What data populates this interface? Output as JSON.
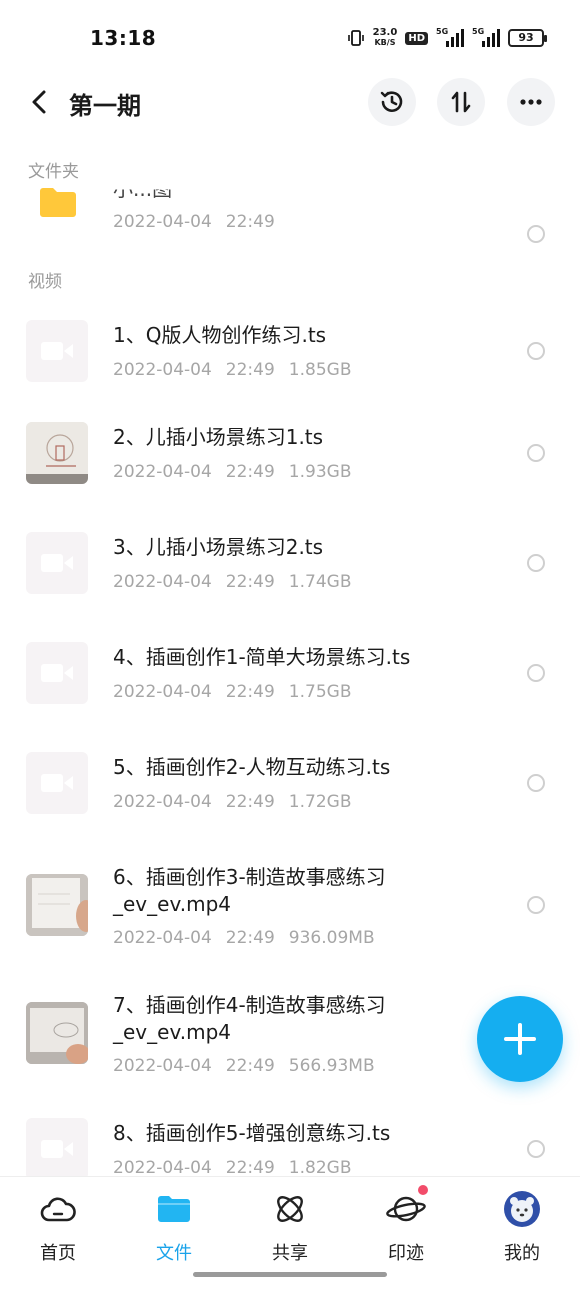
{
  "status_bar": {
    "time": "13:18",
    "speed_value": "23.0",
    "speed_unit": "KB/S",
    "hd": "HD",
    "network_1": "5G",
    "network_2": "5G",
    "battery": "93"
  },
  "header": {
    "title": "第一期",
    "back_icon": "chevron-left-icon",
    "history_icon": "history-icon",
    "sort_icon": "sort-icon",
    "more_icon": "more-icon"
  },
  "sections": {
    "folders_label": "文件夹",
    "videos_label": "视频"
  },
  "folders": [
    {
      "name": "小...图",
      "date": "2022-04-04",
      "time": "22:49"
    }
  ],
  "videos": [
    {
      "name": "1、Q版人物创作练习.ts",
      "date": "2022-04-04",
      "time": "22:49",
      "size": "1.85GB",
      "thumb": "video-placeholder-icon"
    },
    {
      "name": "2、儿插小场景练习1.ts",
      "date": "2022-04-04",
      "time": "22:49",
      "size": "1.93GB",
      "thumb": "sketch-thumbnail"
    },
    {
      "name": "3、儿插小场景练习2.ts",
      "date": "2022-04-04",
      "time": "22:49",
      "size": "1.74GB",
      "thumb": "video-placeholder-icon"
    },
    {
      "name": "4、插画创作1-简单大场景练习.ts",
      "date": "2022-04-04",
      "time": "22:49",
      "size": "1.75GB",
      "thumb": "video-placeholder-icon"
    },
    {
      "name": "5、插画创作2-人物互动练习.ts",
      "date": "2022-04-04",
      "time": "22:49",
      "size": "1.72GB",
      "thumb": "video-placeholder-icon"
    },
    {
      "name": "6、插画创作3-制造故事感练习_ev_ev.mp4",
      "date": "2022-04-04",
      "time": "22:49",
      "size": "936.09MB",
      "thumb": "drawing-thumbnail"
    },
    {
      "name": "7、插画创作4-制造故事感练习_ev_ev.mp4",
      "date": "2022-04-04",
      "time": "22:49",
      "size": "566.93MB",
      "thumb": "drawing-thumbnail"
    },
    {
      "name": "8、插画创作5-增强创意练习.ts",
      "date": "2022-04-04",
      "time": "22:49",
      "size": "1.82GB",
      "thumb": "video-placeholder-icon"
    }
  ],
  "fab": {
    "icon": "plus-icon"
  },
  "bottom_nav": [
    {
      "label": "首页",
      "icon": "cloud-icon",
      "active": false
    },
    {
      "label": "文件",
      "icon": "folder-icon",
      "active": true
    },
    {
      "label": "共享",
      "icon": "atom-icon",
      "active": false
    },
    {
      "label": "印迹",
      "icon": "planet-icon",
      "active": false,
      "badge_dot": true
    },
    {
      "label": "我的",
      "icon": "avatar-icon",
      "active": false
    }
  ],
  "colors": {
    "accent": "#1aa3ea",
    "fab": "#15aef0",
    "folder": "#ffc83a",
    "meta_text": "#a6a6a6",
    "badge": "#f24c6a"
  }
}
